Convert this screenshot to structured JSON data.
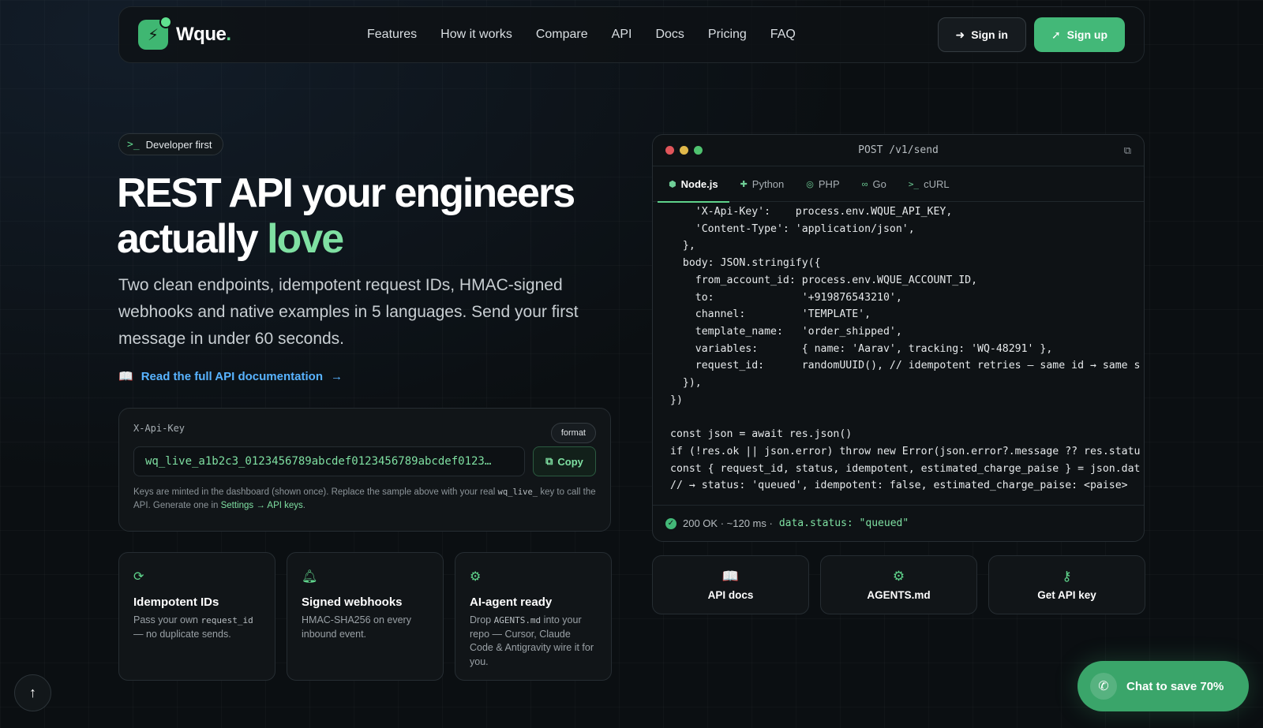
{
  "brand": {
    "name": "Wque",
    "dot": "."
  },
  "nav": {
    "links": [
      "Features",
      "How it works",
      "Compare",
      "API",
      "Docs",
      "Pricing",
      "FAQ"
    ],
    "signin": "Sign in",
    "signup": "Sign up"
  },
  "hero": {
    "pill": "Developer first",
    "title_line1": "REST API your engineers",
    "title_line2_plain": "actually ",
    "title_line2_accent": "love",
    "subtitle": "Two clean endpoints, idempotent request IDs, HMAC-signed webhooks and native examples in 5 languages. Send your first message in under 60 seconds.",
    "doc_link": "Read the full API documentation"
  },
  "key_card": {
    "label": "X-Api-Key",
    "format": "format",
    "value": "wq_live_a1b2c3_0123456789abcdef0123456789abcdef0123…",
    "copy": "Copy",
    "note_a": "Keys are minted in the dashboard (shown once). Replace the sample above with your real ",
    "note_code": "wq_live_",
    "note_b": " key to call the API. Generate one in ",
    "note_link": "Settings → API keys",
    "note_c": "."
  },
  "features": [
    {
      "title": "Idempotent IDs",
      "desc_a": "Pass your own ",
      "desc_code": "request_id",
      "desc_b": " — no duplicate sends."
    },
    {
      "title": "Signed webhooks",
      "desc_a": "HMAC-SHA256 on every inbound event.",
      "desc_code": "",
      "desc_b": ""
    },
    {
      "title": "AI-agent ready",
      "desc_a": "Drop ",
      "desc_code": "AGENTS.md",
      "desc_b": " into your repo — Cursor, Claude Code & Antigravity wire it for you."
    }
  ],
  "code_panel": {
    "title": "POST /v1/send",
    "tabs": [
      "Node.js",
      "Python",
      "PHP",
      "Go",
      "cURL"
    ],
    "active_tab": "Node.js",
    "code": "    'X-Api-Key':    process.env.WQUE_API_KEY,\n    'Content-Type': 'application/json',\n  },\n  body: JSON.stringify({\n    from_account_id: process.env.WQUE_ACCOUNT_ID,\n    to:              '+919876543210',\n    channel:         'TEMPLATE',\n    template_name:   'order_shipped',\n    variables:       { name: 'Aarav', tracking: 'WQ-48291' },\n    request_id:      randomUUID(), // idempotent retries — same id → same s\n  }),\n})\n\nconst json = await res.json()\nif (!res.ok || json.error) throw new Error(json.error?.message ?? res.statu\nconst { request_id, status, idempotent, estimated_charge_paise } = json.dat\n// → status: 'queued', idempotent: false, estimated_charge_paise: <paise>",
    "status": "200 OK · ~120 ms ·",
    "status_data": "data.status: \"queued\""
  },
  "quick_links": [
    "API docs",
    "AGENTS.md",
    "Get API key"
  ],
  "chat": "Chat to save 70%",
  "colors": {
    "accent": "#43b878",
    "accent_light": "#7fe0a2",
    "link": "#58b3ff",
    "bg": "#0b0f12"
  }
}
